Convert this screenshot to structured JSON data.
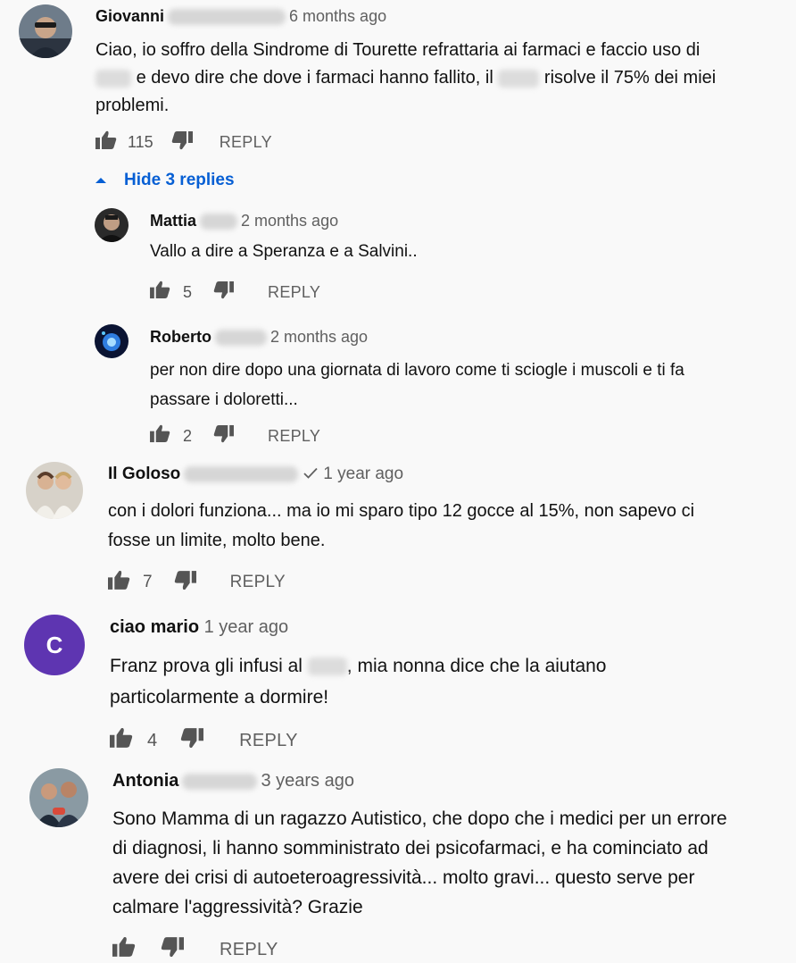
{
  "comments": [
    {
      "author": "Giovanni",
      "time": "6 months ago",
      "text_a": "Ciao, io soffro della Sindrome di Tourette refrattaria ai farmaci e faccio uso di",
      "text_b": "e devo dire che dove i farmaci hanno fallito, il",
      "text_c": "risolve il 75% dei miei",
      "text_d": "problemi.",
      "likes": "115",
      "reply": "REPLY",
      "hide_replies": "Hide 3 replies",
      "replies": [
        {
          "author": "Mattia",
          "time": "2 months ago",
          "text": "Vallo a dire a Speranza e a Salvini..",
          "likes": "5",
          "reply": "REPLY"
        },
        {
          "author": "Roberto",
          "time": "2 months ago",
          "text_a": "per non dire dopo una giornata di lavoro come ti sciogle i muscoli e ti fa",
          "text_b": "passare i doloretti...",
          "likes": "2",
          "reply": "REPLY"
        }
      ]
    },
    {
      "author": "Il Goloso",
      "time": "1 year ago",
      "text_a": "con i dolori funziona... ma io mi sparo tipo 12 gocce al 15%, non sapevo ci",
      "text_b": "fosse un limite, molto bene.",
      "likes": "7",
      "reply": "REPLY"
    },
    {
      "author": "ciao mario",
      "avatar_letter": "C",
      "time": "1 year ago",
      "text_a": "Franz prova gli infusi al",
      "text_b": ", mia nonna dice che la aiutano",
      "text_c": "particolarmente a dormire!",
      "likes": "4",
      "reply": "REPLY"
    },
    {
      "author": "Antonia",
      "time": "3 years ago",
      "text_a": "Sono Mamma di un ragazzo Autistico, che dopo che i medici per un errore",
      "text_b": "di diagnosi, li hanno somministrato dei psicofarmaci, e ha cominciato ad",
      "text_c": "avere dei crisi di autoeteroagressività... molto gravi... questo serve per",
      "text_d": "calmare l'aggressività? Grazie",
      "reply": "REPLY"
    }
  ],
  "colors": {
    "link": "#065fd4",
    "avatar_purple": "#5e35b1"
  }
}
